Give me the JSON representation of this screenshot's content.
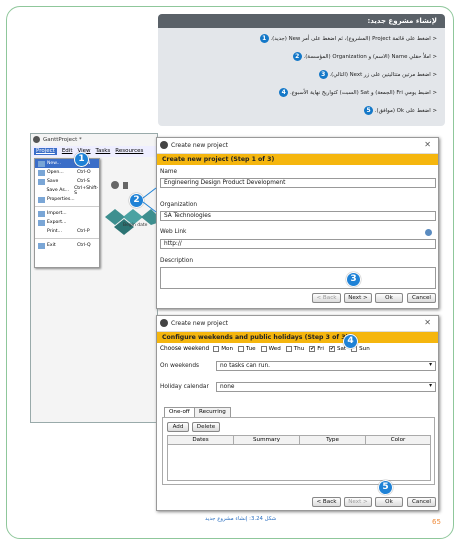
{
  "instructions": {
    "heading": "لإنشاء مشروع جديد:",
    "steps": [
      {
        "num": "1",
        "text": "< اضغط على قائمة Project (المشروع)، ثم اضغط على أمر New (جديد)."
      },
      {
        "num": "2",
        "text": "< املأ حقلي Name (الاسم) و Organization (المؤسسة)."
      },
      {
        "num": "3",
        "text": "< اضغط مرتين متتاليتين على زر Next (التالي)."
      },
      {
        "num": "4",
        "text": "< اضبط يومي Fri (الجمعة) و Sat (السبت) كتواريخ نهاية الأسبوع."
      },
      {
        "num": "5",
        "text": "< اضغط على Ok (موافق)."
      }
    ]
  },
  "ganttproject": {
    "title": "GanttProject *",
    "menu": [
      "Project",
      "Edit",
      "View",
      "Tasks",
      "Resources"
    ],
    "menu_items": [
      {
        "label": "New...",
        "shortcut": "Ctrl-N"
      },
      {
        "label": "Open...",
        "shortcut": "Ctrl-O"
      },
      {
        "label": "Save",
        "shortcut": "Ctrl-S"
      },
      {
        "label": "Save As...",
        "shortcut": "Ctrl+Shift-S"
      },
      {
        "label": "Properties...",
        "shortcut": ""
      },
      {
        "label": "Import...",
        "shortcut": ""
      },
      {
        "label": "Export...",
        "shortcut": ""
      },
      {
        "label": "Print...",
        "shortcut": "Ctrl-P"
      },
      {
        "label": "Exit",
        "shortcut": "Ctrl-Q"
      }
    ],
    "canvas_text": "Begin date"
  },
  "dialog1": {
    "title": "Create new project",
    "step": "Create new project (Step 1 of 3)",
    "name_label": "Name",
    "name_value": "Engineering Design Product Development",
    "org_label": "Organization",
    "org_value": "SA Technologies",
    "web_label": "Web Link",
    "web_value": "http://",
    "desc_label": "Description",
    "back": "< Back",
    "next": "Next >",
    "ok": "Ok",
    "cancel": "Cancel"
  },
  "dialog2": {
    "title": "Create new project",
    "step": "Configure weekends and public holidays (Step 3 of 3)",
    "weekend_label": "Choose weekend",
    "days": [
      {
        "label": "Mon",
        "checked": false
      },
      {
        "label": "Tue",
        "checked": false
      },
      {
        "label": "Wed",
        "checked": false
      },
      {
        "label": "Thu",
        "checked": false
      },
      {
        "label": "Fri",
        "checked": true
      },
      {
        "label": "Sat",
        "checked": true
      },
      {
        "label": "Sun",
        "checked": false
      }
    ],
    "on_weekends_label": "On weekends",
    "on_weekends_value": "no tasks can run.",
    "holiday_label": "Holiday calendar",
    "holiday_value": "none",
    "tab1": "One-off",
    "tab2": "Recurring",
    "add": "Add",
    "delete": "Delete",
    "columns": [
      "Dates",
      "Summary",
      "Type",
      "Color"
    ],
    "back": "< Back",
    "next": "Next >",
    "ok": "Ok",
    "cancel": "Cancel"
  },
  "callouts": [
    "1",
    "2",
    "3",
    "4",
    "5"
  ],
  "caption": "شكل 3.24: إنشاء مشروع جديد",
  "page_number": "65",
  "colors": {
    "step_bar": "#f5b60e",
    "callout": "#1f82d6",
    "frame": "#8fc79b"
  }
}
